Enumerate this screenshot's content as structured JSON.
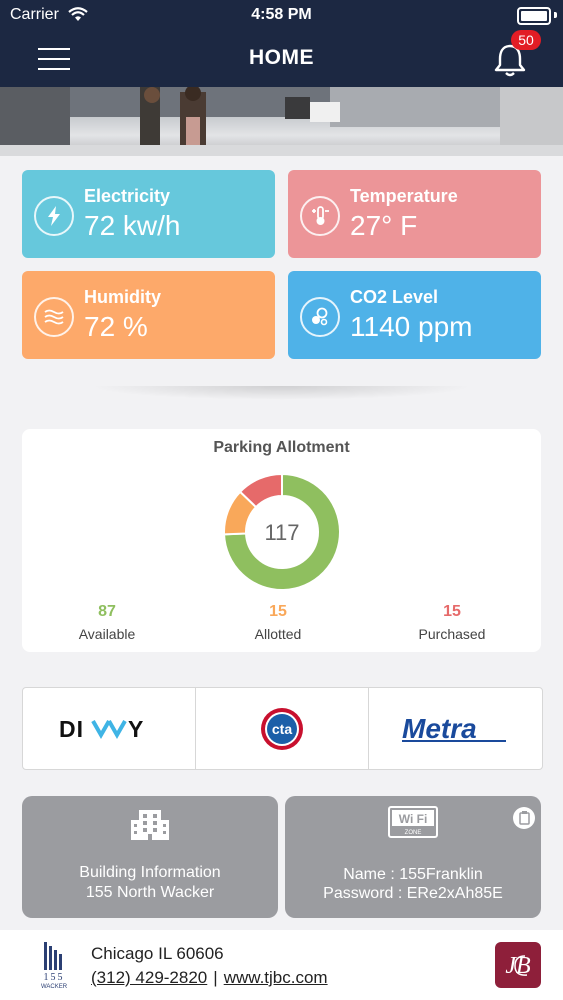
{
  "status_bar": {
    "carrier": "Carrier",
    "time": "4:58 PM"
  },
  "nav": {
    "title": "HOME",
    "notification_count": "50",
    "menu_icon": "hamburger-icon",
    "bell_icon": "bell-icon"
  },
  "tiles": [
    {
      "label": "Electricity",
      "value": "72 kw/h",
      "icon": "lightning-icon",
      "color": "#66c8dc"
    },
    {
      "label": "Temperature",
      "value": "27° F",
      "icon": "thermometer-icon",
      "color": "#ec9598"
    },
    {
      "label": "Humidity",
      "value": "72 %",
      "icon": "humidity-waves-icon",
      "color": "#fda96a"
    },
    {
      "label": "CO2 Level",
      "value": "1140 ppm",
      "icon": "co2-bubbles-icon",
      "color": "#4fb2e8"
    }
  ],
  "parking": {
    "title": "Parking Allotment",
    "total": "117",
    "available": {
      "value": "87",
      "label": "Available",
      "color": "#8fbf5f"
    },
    "allotted": {
      "value": "15",
      "label": "Allotted",
      "color": "#f9a85a"
    },
    "purchased": {
      "value": "15",
      "label": "Purchased",
      "color": "#e66a6a"
    }
  },
  "transit": [
    {
      "name": "DIVVY",
      "text": "DIVVY"
    },
    {
      "name": "CTA",
      "text": "cta"
    },
    {
      "name": "Metra",
      "text": "Metra"
    }
  ],
  "building_info": {
    "line1": "Building Information",
    "line2": "155 North Wacker",
    "icon": "building-icon"
  },
  "wifi": {
    "name_line": "Name : 155Franklin",
    "password_line": "Password : ERe2xAh85E",
    "icon": "wifi-zone-icon",
    "copy_icon": "copy-icon",
    "zone_text": "ZONE",
    "wifi_text": "Wi Fi"
  },
  "footer": {
    "address": "Chicago IL 60606",
    "phone": "(312) 429-2820",
    "separator": "|",
    "website": "www.tjbc.com",
    "building_logo_text": "155",
    "building_logo_sub": "WACKER"
  }
}
